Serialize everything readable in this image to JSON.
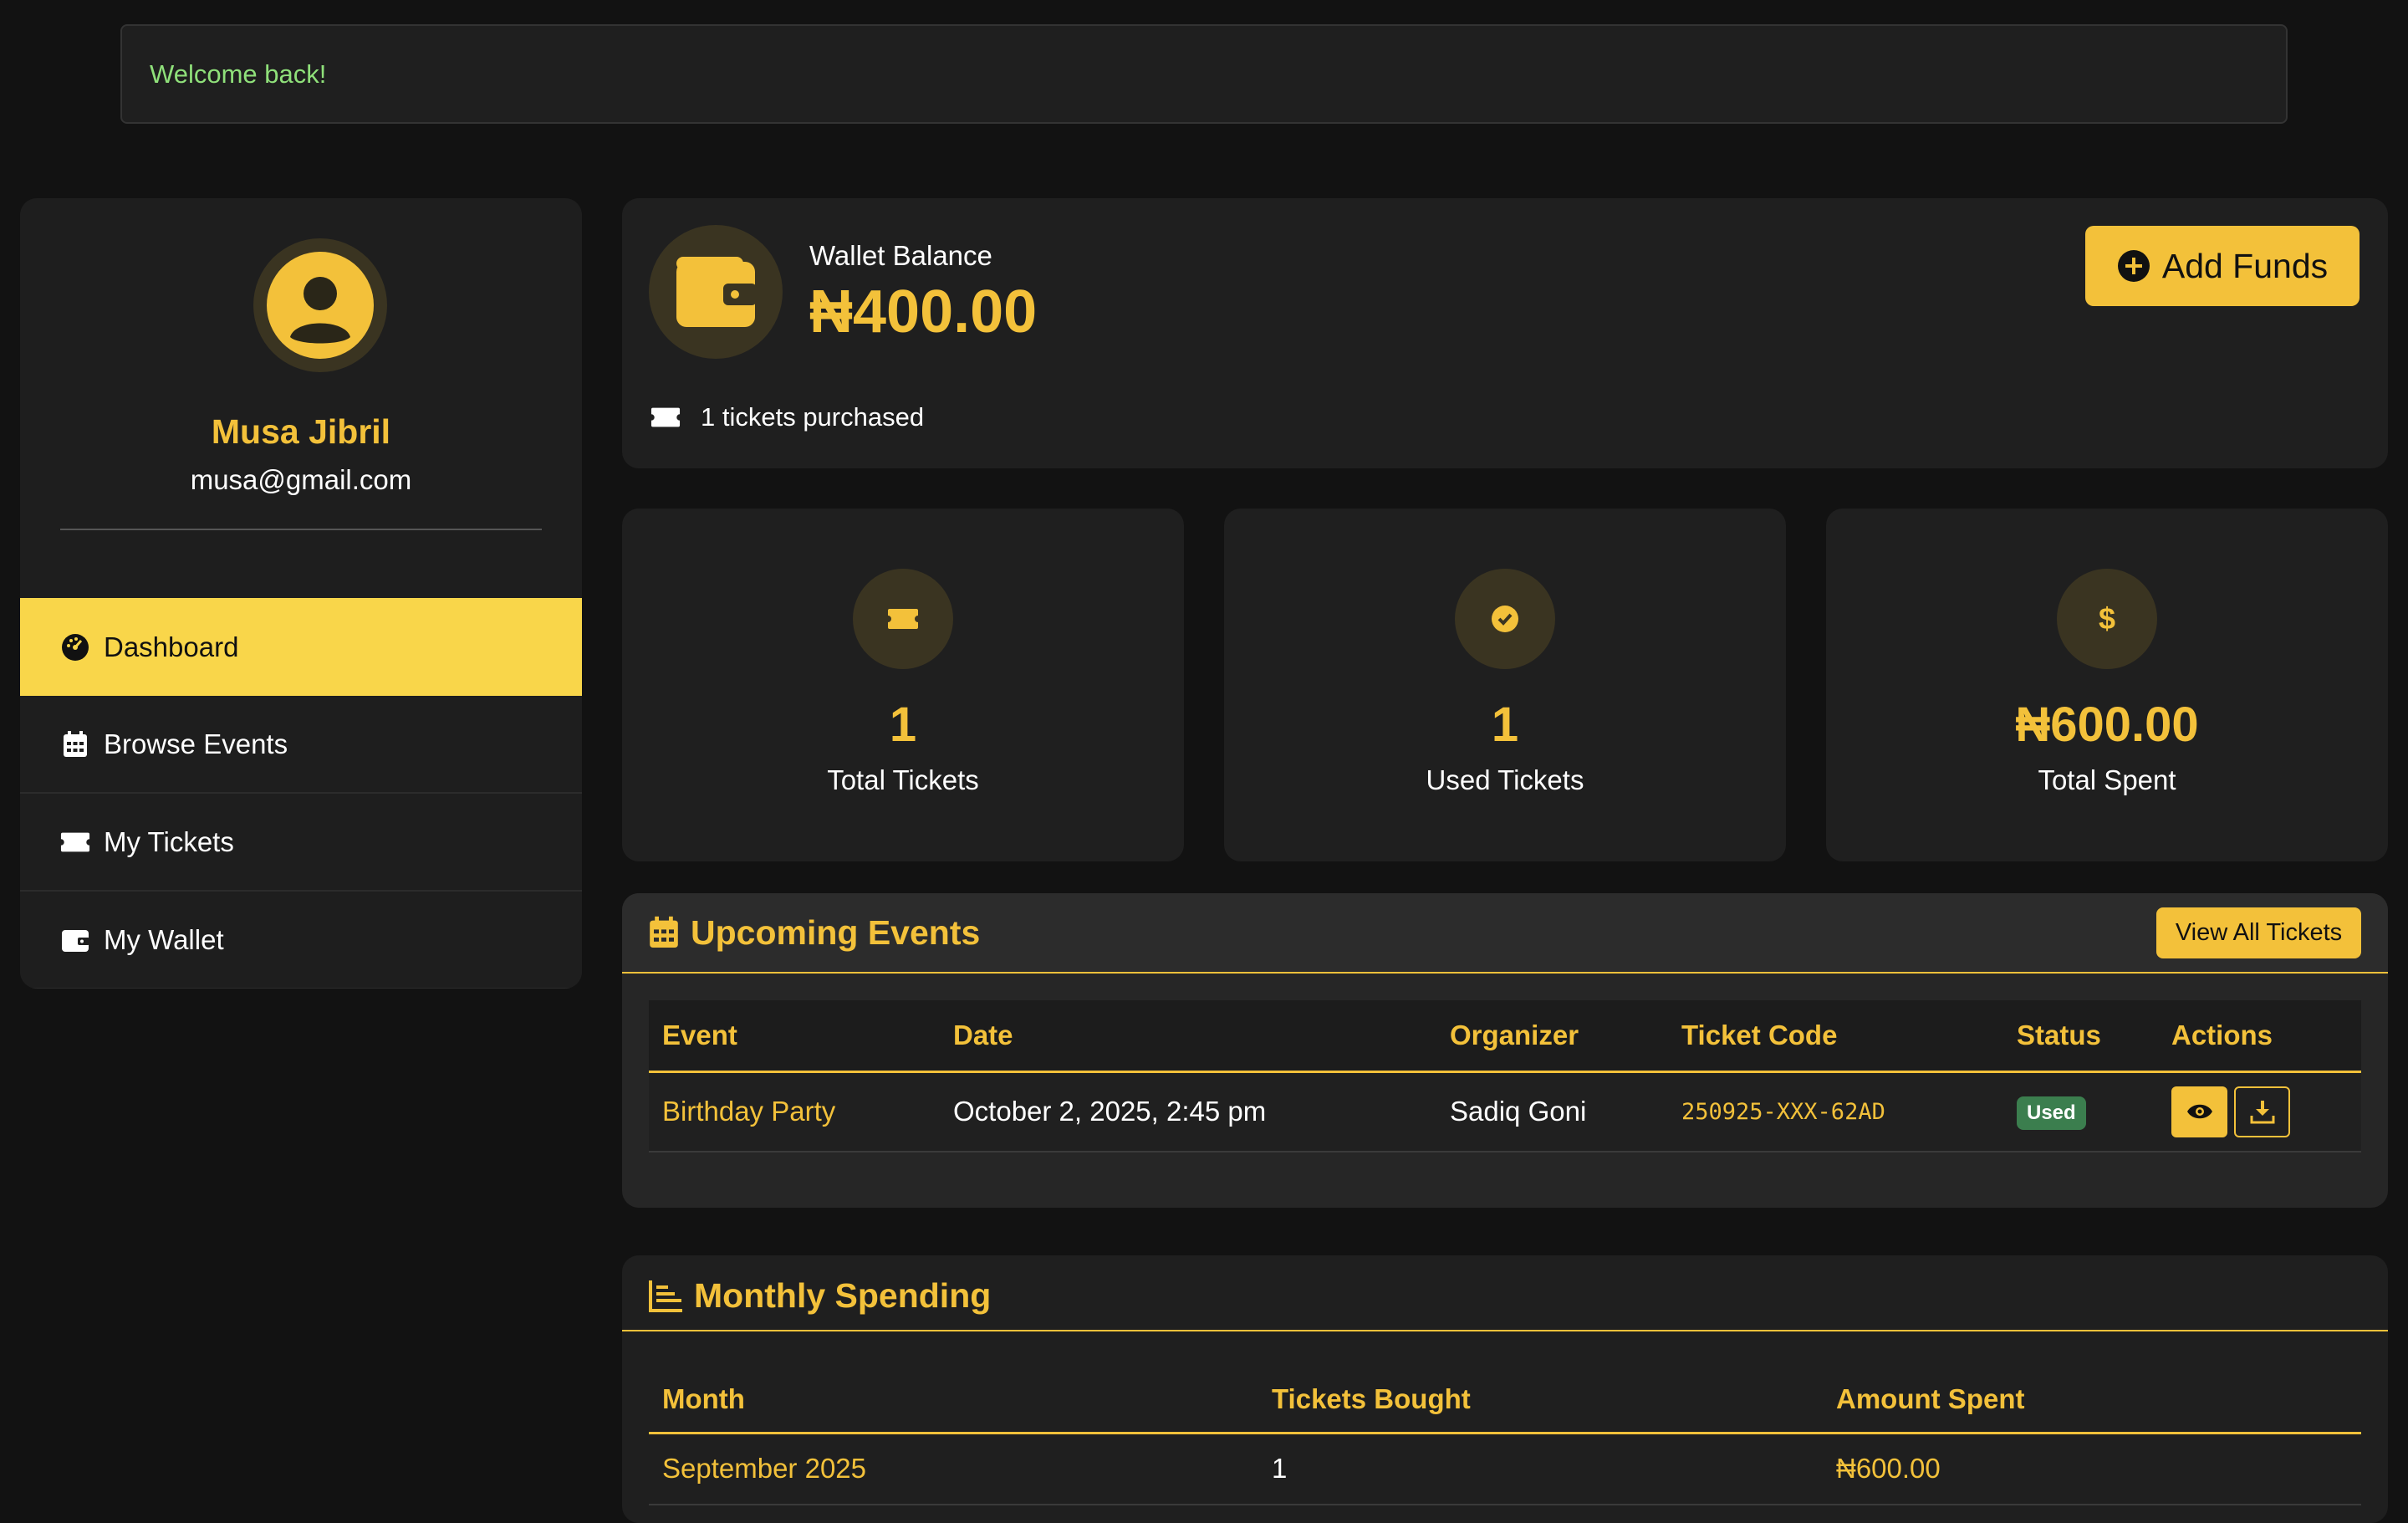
{
  "alert": {
    "text": "Welcome back!"
  },
  "sidebar": {
    "user_name": "Musa Jibril",
    "user_email": "musa@gmail.com",
    "items": [
      {
        "label": "Dashboard",
        "icon": "gauge-icon",
        "active": true
      },
      {
        "label": "Browse Events",
        "icon": "calendar-icon",
        "active": false
      },
      {
        "label": "My Tickets",
        "icon": "ticket-icon",
        "active": false
      },
      {
        "label": "My Wallet",
        "icon": "wallet-icon",
        "active": false
      }
    ]
  },
  "wallet": {
    "label": "Wallet Balance",
    "amount": "₦400.00",
    "add_funds_label": "Add Funds",
    "tickets_purchased": "1 tickets purchased"
  },
  "stats": [
    {
      "value": "1",
      "label": "Total Tickets",
      "icon": "ticket-icon"
    },
    {
      "value": "1",
      "label": "Used Tickets",
      "icon": "check-circle-icon"
    },
    {
      "value": "₦600.00",
      "label": "Total Spent",
      "icon": "dollar-icon"
    }
  ],
  "upcoming": {
    "title": "Upcoming Events",
    "view_all_label": "View All Tickets",
    "columns": [
      "Event",
      "Date",
      "Organizer",
      "Ticket Code",
      "Status",
      "Actions"
    ],
    "rows": [
      {
        "event": "Birthday Party",
        "date": "October 2, 2025, 2:45 pm",
        "organizer": "Sadiq Goni",
        "code": "250925-XXX-62AD",
        "status": "Used"
      }
    ]
  },
  "monthly": {
    "title": "Monthly Spending",
    "columns": [
      "Month",
      "Tickets Bought",
      "Amount Spent"
    ],
    "rows": [
      {
        "month": "September 2025",
        "tickets": "1",
        "amount": "₦600.00"
      }
    ]
  },
  "colors": {
    "accent": "#f3c13a",
    "active_nav": "#f9d64a",
    "success": "#3b7e4e",
    "welcome": "#8fe07a"
  }
}
